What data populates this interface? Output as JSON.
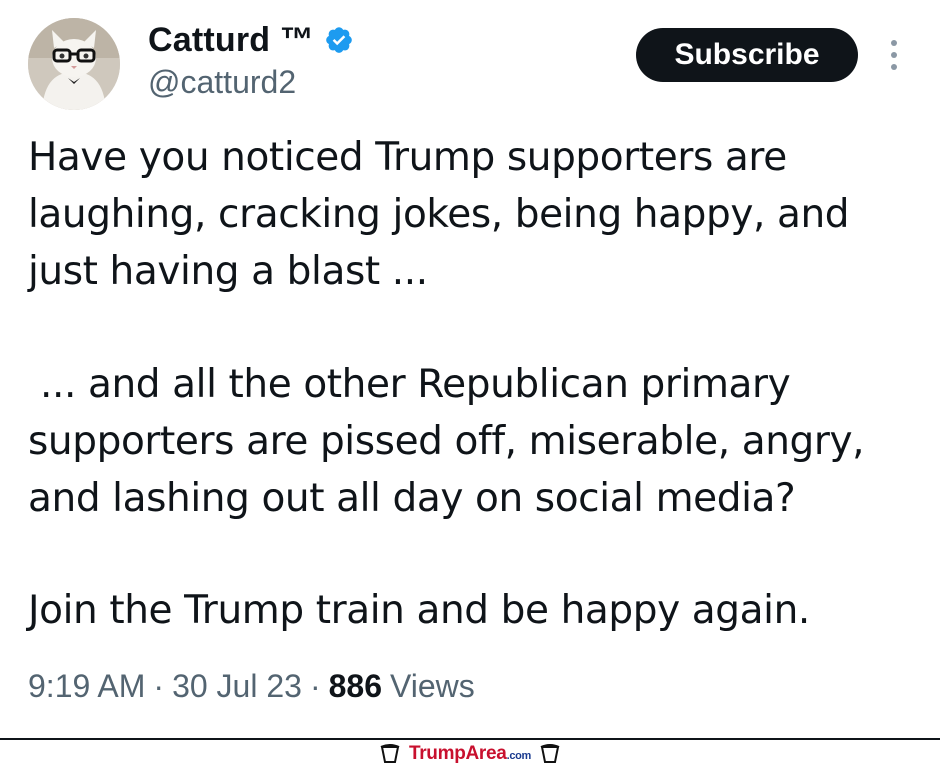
{
  "author": {
    "display_name": "Catturd ™",
    "handle": "@catturd2"
  },
  "actions": {
    "subscribe_label": "Subscribe"
  },
  "tweet": {
    "lines": [
      "Have you noticed Trump supporters are",
      "laughing, cracking jokes, being happy, and",
      "just having a blast ...",
      " ... and all the other Republican primary",
      "supporters are pissed off, miserable, angry,",
      "and lashing out all day on social media?",
      "Join the Trump train and be happy again."
    ]
  },
  "meta": {
    "time": "9:19 AM",
    "separator": "·",
    "date": "30 Jul 23",
    "views_count": "886",
    "views_label": "Views"
  },
  "watermark": {
    "brand_main": "TrumpArea",
    "brand_tld": ".com"
  },
  "colors": {
    "text": "#0f1419",
    "muted": "#536471",
    "verified": "#1d9bf0",
    "button_bg": "#0f1419",
    "watermark": "#c8102e"
  }
}
